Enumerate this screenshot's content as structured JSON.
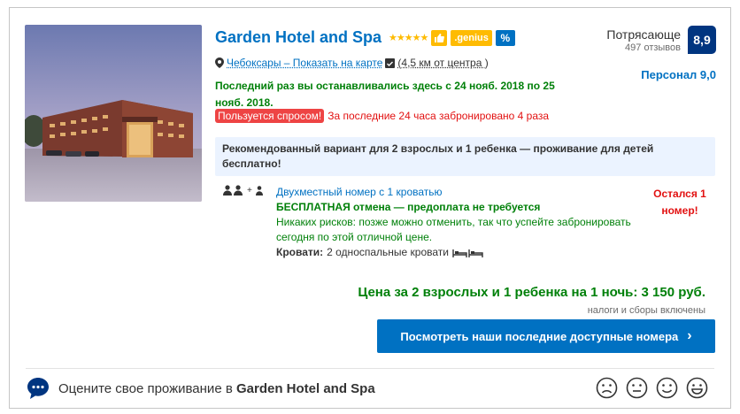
{
  "hotel": {
    "name": "Garden Hotel and Spa",
    "stars": "★★★★★",
    "genius_label": ".genius",
    "discount_symbol": "%",
    "city_link": "Чебоксары – Показать на карте",
    "distance": "(4,5 км от центра )"
  },
  "stay_note": "Последний раз вы останавливались здесь с 24 нояб. 2018 по 25 нояб. 2018.",
  "demand": {
    "badge": "Пользуется спросом!",
    "text": "За последние 24 часа забронировано 4 раза"
  },
  "recommendation": "Рекомендованный вариант для 2 взрослых и 1 ребенка — проживание для детей бесплатно!",
  "room": {
    "plus": "+",
    "type": "Двухместный номер с 1 кроватью",
    "free_cancel": "БЕСПЛАТНАЯ отмена — предоплата не требуется",
    "no_risk": "Никаких рисков: позже можно отменить, так что успейте забронировать сегодня по этой отличной цене.",
    "beds_label": "Кровати:",
    "beds_value": "2 односпальные кровати"
  },
  "availability": "Остался 1 номер!",
  "score": {
    "label": "Потрясающе",
    "reviews": "497 отзывов",
    "value": "8,9",
    "staff": "Персонал 9,0"
  },
  "price": {
    "line": "Цена за 2 взрослых и 1 ребенка на 1 ночь: 3 150 руб.",
    "taxes": "налоги и сборы включены"
  },
  "cta": {
    "label": "Посмотреть наши последние доступные номера",
    "arrow": "›"
  },
  "rate": {
    "prefix": "Оцените свое проживание в ",
    "hotel": "Garden Hotel and Spa"
  },
  "colors": {
    "brand_blue": "#0071c2",
    "dark_blue": "#003580",
    "green": "#008009",
    "red": "#e21111",
    "yellow": "#febb02"
  }
}
